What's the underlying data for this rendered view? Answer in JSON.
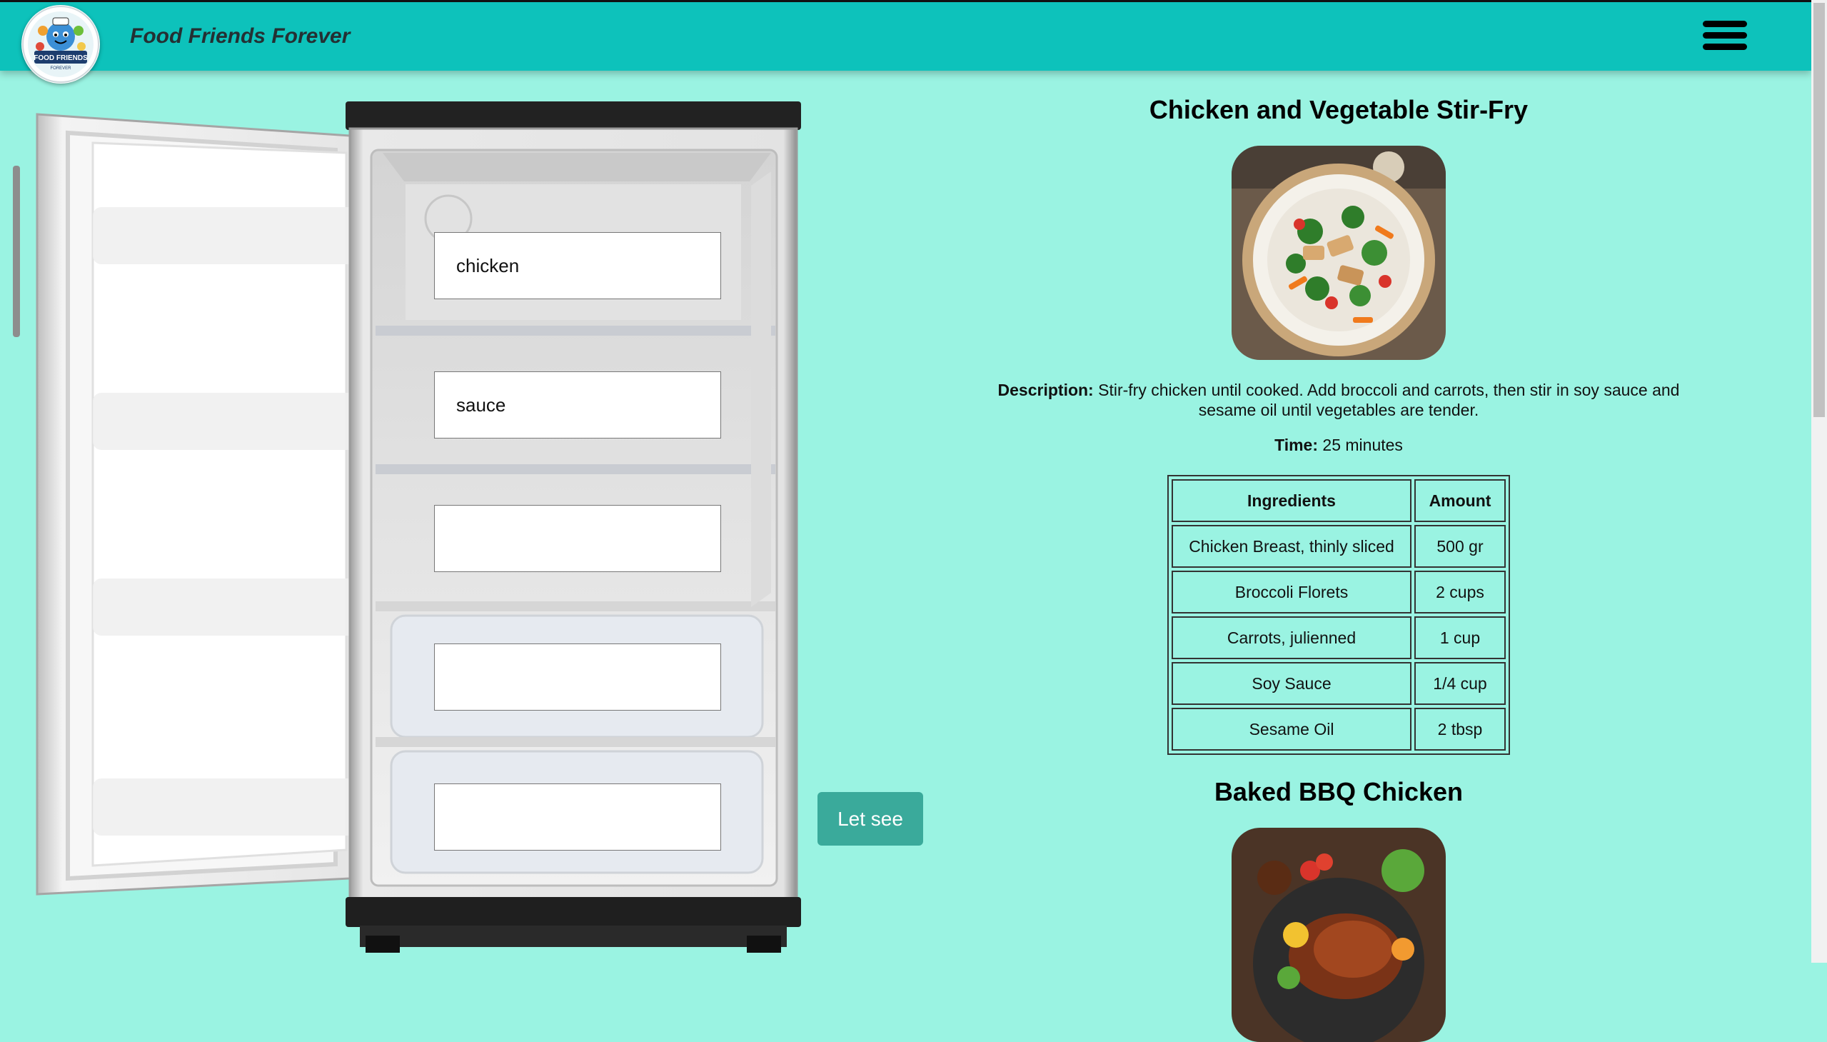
{
  "header": {
    "title": "Food Friends Forever",
    "logo_text": "FOOD FRIENDS",
    "logo_subtext": "FOREVER"
  },
  "fridge": {
    "inputs": [
      {
        "value": "chicken"
      },
      {
        "value": "sauce"
      },
      {
        "value": ""
      },
      {
        "value": ""
      },
      {
        "value": ""
      }
    ],
    "submit_label": "Let see"
  },
  "recipes": [
    {
      "title": "Chicken and Vegetable Stir-Fry",
      "description_label": "Description:",
      "description": "Stir-fry chicken until cooked. Add broccoli and carrots, then stir in soy sauce and sesame oil until vegetables are tender.",
      "time_label": "Time:",
      "time": "25 minutes",
      "table_headers": {
        "ingredient": "Ingredients",
        "amount": "Amount"
      },
      "ingredients": [
        {
          "name": "Chicken Breast, thinly sliced",
          "amount": "500 gr"
        },
        {
          "name": "Broccoli Florets",
          "amount": "2 cups"
        },
        {
          "name": "Carrots, julienned",
          "amount": "1 cup"
        },
        {
          "name": "Soy Sauce",
          "amount": "1/4 cup"
        },
        {
          "name": "Sesame Oil",
          "amount": "2 tbsp"
        }
      ]
    },
    {
      "title": "Baked BBQ Chicken"
    }
  ],
  "colors": {
    "background": "#9af3e2",
    "header": "#0dc2bb",
    "button": "#3aaa9b"
  }
}
